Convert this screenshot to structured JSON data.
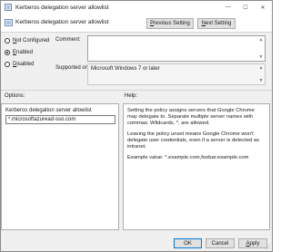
{
  "window": {
    "title": "Kerberos delegation server allowlist",
    "controls": {
      "minimize": "—",
      "maximize": "☐",
      "close": "✕"
    }
  },
  "header": {
    "title": "Kerberos delegation server allowlist",
    "previous_label_underlined": "P",
    "previous_label_rest": "revious Setting",
    "next_label_underlined": "N",
    "next_label_rest": "ext Setting"
  },
  "state": {
    "options": [
      {
        "prefix": "N",
        "rest": "ot Configured",
        "selected": false
      },
      {
        "prefix": "E",
        "rest": "nabled",
        "selected": true
      },
      {
        "prefix": "D",
        "rest": "isabled",
        "selected": false
      }
    ]
  },
  "comment": {
    "label": "Comment:"
  },
  "supported": {
    "label": "Supported on:",
    "value": "Microsoft Windows 7 or later"
  },
  "options_panel": {
    "heading": "Options:",
    "field_label": "Kerberos delegation server allowlist",
    "field_value": "*.microsoftazuread-sso.com"
  },
  "help_panel": {
    "heading": "Help:",
    "paragraphs": [
      "Setting the policy assigns servers that Google Chrome may delegate to. Separate multiple server names with commas. Wildcards, *, are allowed.",
      "Leaving the policy unset means Google Chrome won't delegate user credentials, even if a server is detected as intranet.",
      "Example value: *.example.com,foobar.example.com"
    ]
  },
  "footer": {
    "ok": "OK",
    "cancel": "Cancel",
    "apply_underlined": "A",
    "apply_rest": "pply"
  },
  "colors": {
    "accent": "#0078d7",
    "dialog_bg": "#f0f0f0",
    "panel_bg": "#ffffff"
  }
}
